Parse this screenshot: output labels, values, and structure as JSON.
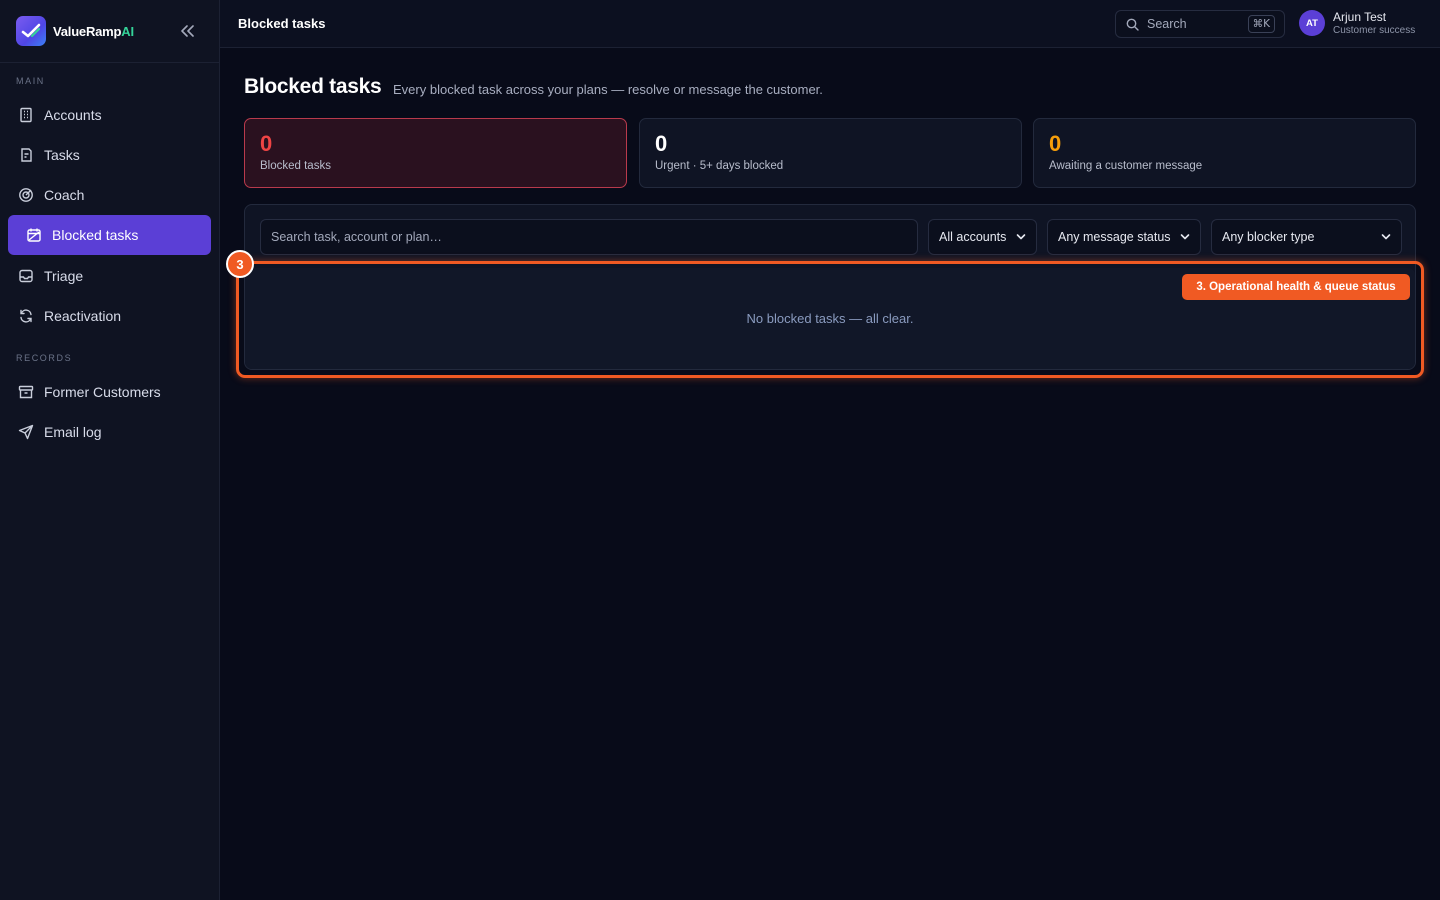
{
  "brand": {
    "name_main": "ValueRamp",
    "name_accent": "AI"
  },
  "sidebar": {
    "main_section": "MAIN",
    "records_section": "RECORDS",
    "items": [
      {
        "label": "Accounts",
        "icon": "building-icon"
      },
      {
        "label": "Tasks",
        "icon": "clipboard-icon"
      },
      {
        "label": "Coach",
        "icon": "target-icon"
      },
      {
        "label": "Blocked tasks",
        "icon": "blocked-calendar-icon",
        "active": true
      },
      {
        "label": "Triage",
        "icon": "inbox-icon"
      },
      {
        "label": "Reactivation",
        "icon": "refresh-icon"
      },
      {
        "label": "Former Customers",
        "icon": "archive-icon"
      },
      {
        "label": "Email log",
        "icon": "send-icon"
      }
    ]
  },
  "topbar": {
    "title": "Blocked tasks",
    "search_label": "Search",
    "shortcut": "⌘K",
    "user": {
      "initials": "AT",
      "name": "Arjun Test",
      "role": "Customer success"
    }
  },
  "page": {
    "title": "Blocked tasks",
    "subtitle": "Every blocked task across your plans — resolve or message the customer."
  },
  "stats": [
    {
      "value": "0",
      "label": "Blocked tasks",
      "color": "#ef4444"
    },
    {
      "value": "0",
      "label": "Urgent · 5+ days blocked",
      "color": "#ffffff"
    },
    {
      "value": "0",
      "label": "Awaiting a customer message",
      "color": "#f59e0b"
    }
  ],
  "filters": {
    "search_placeholder": "Search task, account or plan…",
    "accounts": "All accounts",
    "message_status": "Any message status",
    "blocker_type": "Any blocker type"
  },
  "empty_state": "No blocked tasks — all clear.",
  "annotation": {
    "number": "3",
    "label": "3. Operational health & queue status",
    "color": "#f05a23"
  },
  "colors": {
    "accent": "#5b3fd6",
    "brand_green": "#34d399"
  }
}
